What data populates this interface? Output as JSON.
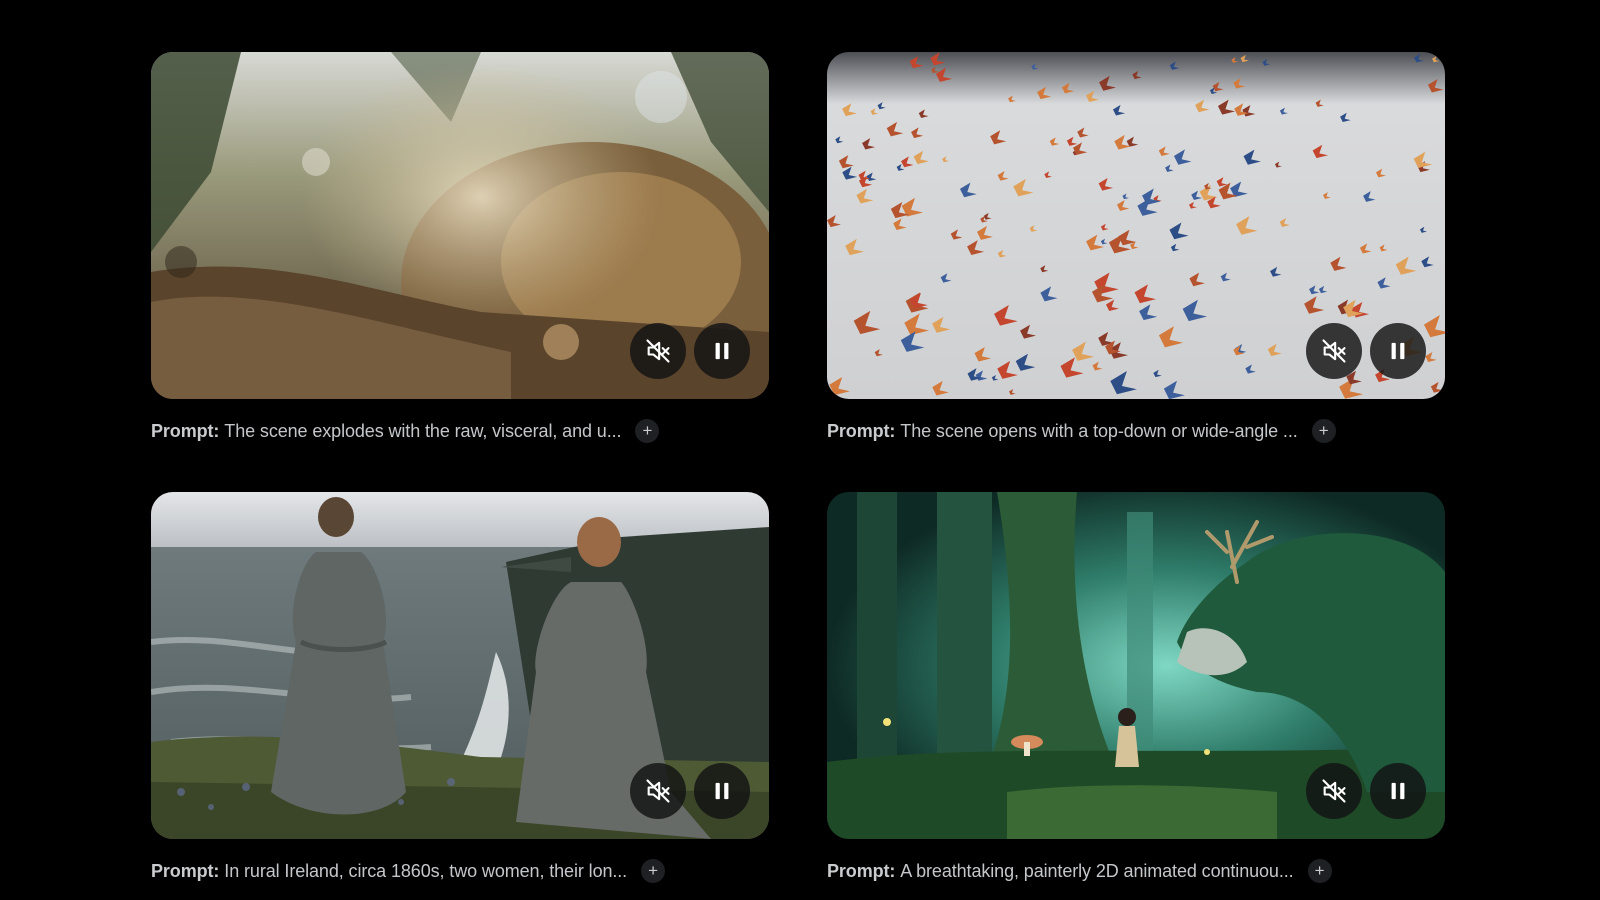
{
  "cards": [
    {
      "prompt_label": "Prompt:",
      "prompt_text": "The scene explodes with the raw, visceral, and u...",
      "expand_label": "+",
      "mute_icon": "volume-off-icon",
      "pause_icon": "pause-icon"
    },
    {
      "prompt_label": "Prompt:",
      "prompt_text": "The scene opens with a top-down or wide-angle ...",
      "expand_label": "+",
      "mute_icon": "volume-off-icon",
      "pause_icon": "pause-icon"
    },
    {
      "prompt_label": "Prompt:",
      "prompt_text": "In rural Ireland, circa 1860s, two women, their lon...",
      "expand_label": "+",
      "mute_icon": "volume-off-icon",
      "pause_icon": "pause-icon"
    },
    {
      "prompt_label": "Prompt:",
      "prompt_text": "A breathtaking, painterly 2D animated continuou...",
      "expand_label": "+",
      "mute_icon": "volume-off-icon",
      "pause_icon": "pause-icon"
    }
  ],
  "colors": {
    "background": "#000000",
    "caption_text": "#c9cbcf",
    "control_bg": "#121214"
  }
}
